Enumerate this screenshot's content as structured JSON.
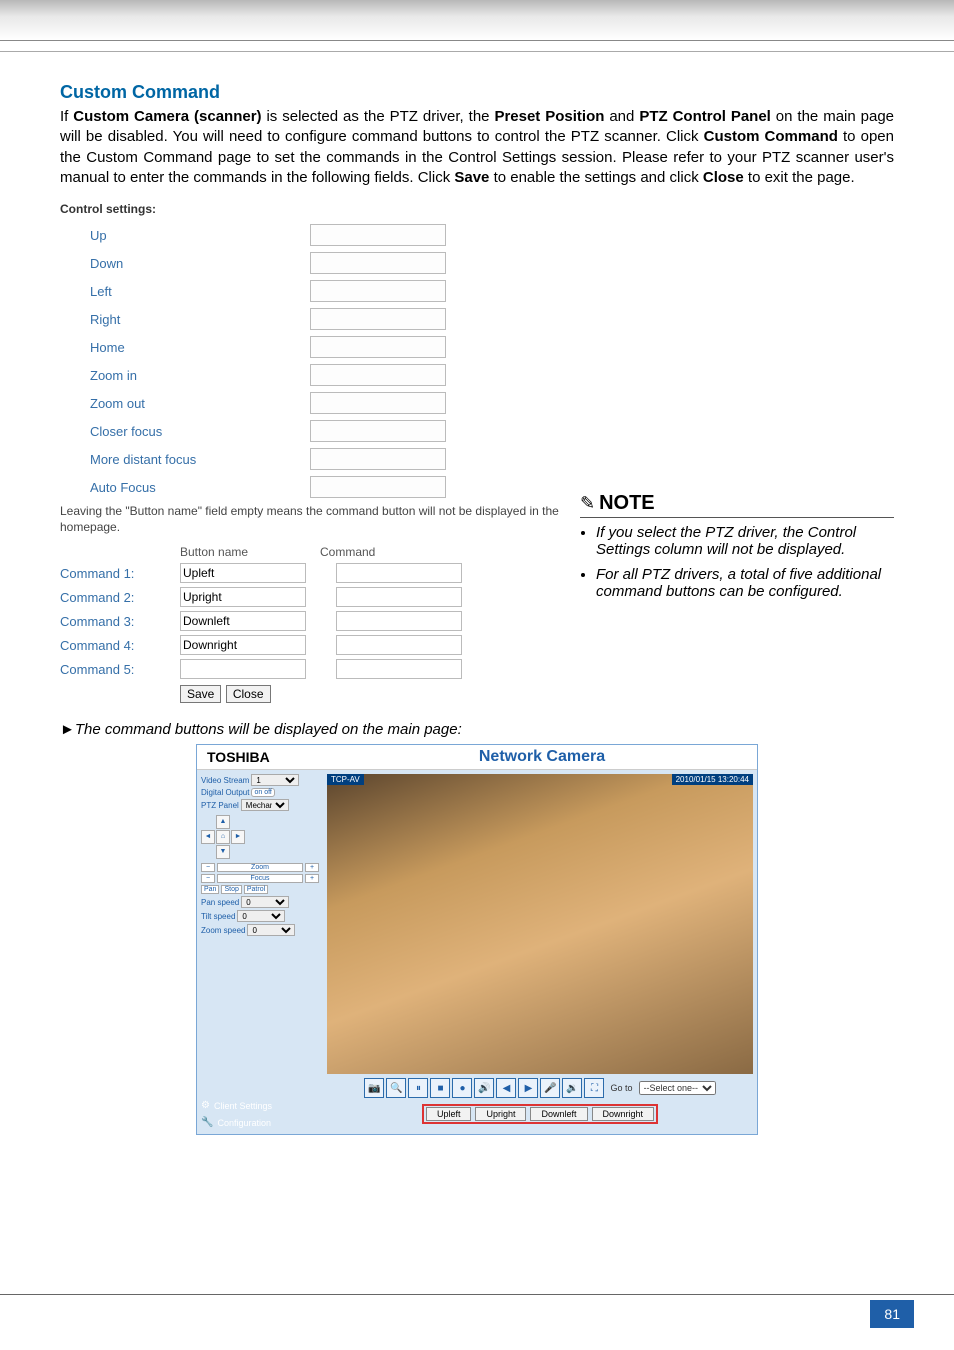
{
  "section_title": "Custom Command",
  "body_html": "If <strong>Custom Camera (scanner)</strong> is selected as the PTZ driver, the <strong>Preset Position</strong> and <strong>PTZ Control Panel</strong> on the main page will be disabled. You will need to configure command buttons to control the PTZ scanner. Click <strong>Custom Command</strong> to open the Custom Command page to set the commands in the Control Settings session. Please refer to your PTZ scanner user's manual to enter the commands in the following fields. Click <strong>Save</strong> to enable the settings and click <strong>Close</strong> to exit the page.",
  "control_settings_title": "Control settings:",
  "control_labels": [
    "Up",
    "Down",
    "Left",
    "Right",
    "Home",
    "Zoom in",
    "Zoom out",
    "Closer focus",
    "More distant focus",
    "Auto Focus"
  ],
  "hint": "Leaving the \"Button name\" field empty means the command button will not be displayed in the homepage.",
  "cmd_header": {
    "c1": "",
    "c2": "Button name",
    "c3": "Command"
  },
  "commands": [
    {
      "label": "Command 1:",
      "name": "Upleft",
      "cmd": ""
    },
    {
      "label": "Command 2:",
      "name": "Upright",
      "cmd": ""
    },
    {
      "label": "Command 3:",
      "name": "Downleft",
      "cmd": ""
    },
    {
      "label": "Command 4:",
      "name": "Downright",
      "cmd": ""
    },
    {
      "label": "Command 5:",
      "name": "",
      "cmd": ""
    }
  ],
  "save_label": "Save",
  "close_label": "Close",
  "note_title": "NOTE",
  "note_items": [
    "If you select the PTZ driver, the Control Settings column will not be displayed.",
    "For all PTZ drivers, a total of five additional command buttons can be configured."
  ],
  "caption": "The command buttons will be displayed on the main page:",
  "camera": {
    "brand": "TOSHIBA",
    "title": "Network Camera",
    "video_label": "TCP-AV",
    "timestamp": "2010/01/15 13:20:44",
    "sidebar": {
      "videoStream": "Video Stream",
      "videoStream_val": "1",
      "digitalOutput": "Digital Output",
      "ptzPanel": "PTZ Panel",
      "ptzPanel_val": "Mechani",
      "zoom": "Zoom",
      "focus": "Focus",
      "pan": "Pan",
      "stop": "Stop",
      "patrol": "Patrol",
      "panSpeed": "Pan speed",
      "panSpeed_val": "0",
      "tiltSpeed": "Tilt speed",
      "tiltSpeed_val": "0",
      "zoomSpeed": "Zoom speed",
      "zoomSpeed_val": "0",
      "clientSettings": "Client Settings",
      "configuration": "Configuration"
    },
    "goto_label": "Go to",
    "goto_val": "--Select one--",
    "cmd_buttons": [
      "Upleft",
      "Upright",
      "Downleft",
      "Downright"
    ]
  },
  "page_number": "81"
}
